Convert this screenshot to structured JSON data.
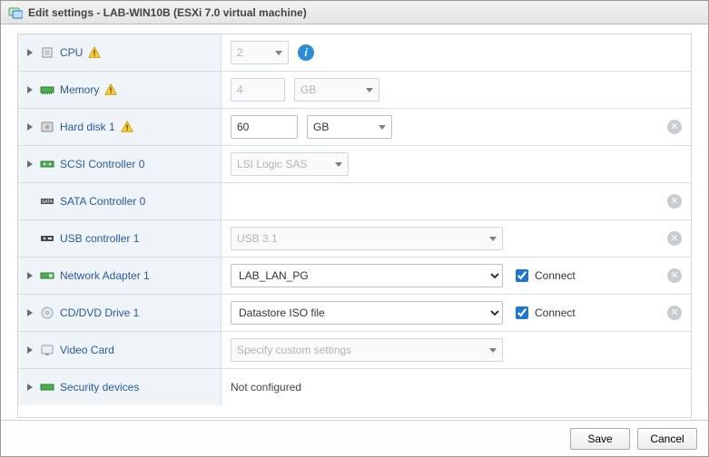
{
  "window": {
    "title": "Edit settings - LAB-WIN10B (ESXi 7.0 virtual machine)"
  },
  "rows": {
    "cpu": {
      "label": "CPU",
      "value": "2",
      "info": true,
      "warn": true,
      "expandable": true
    },
    "memory": {
      "label": "Memory",
      "value": "4",
      "unit": "GB",
      "warn": true,
      "expandable": true
    },
    "harddisk1": {
      "label": "Hard disk 1",
      "value": "60",
      "unit": "GB",
      "warn": true,
      "expandable": true,
      "removable": true
    },
    "scsi0": {
      "label": "SCSI Controller 0",
      "value": "LSI Logic SAS",
      "expandable": true
    },
    "sata0": {
      "label": "SATA Controller 0",
      "removable": true
    },
    "usb1": {
      "label": "USB controller 1",
      "value": "USB 3.1",
      "removable": true
    },
    "net1": {
      "label": "Network Adapter 1",
      "value": "LAB_LAN_PG",
      "connect_label": "Connect",
      "connected": true,
      "expandable": true,
      "removable": true
    },
    "cddvd1": {
      "label": "CD/DVD Drive 1",
      "value": "Datastore ISO file",
      "connect_label": "Connect",
      "connected": true,
      "expandable": true,
      "removable": true
    },
    "video": {
      "label": "Video Card",
      "placeholder": "Specify custom settings",
      "expandable": true
    },
    "security": {
      "label": "Security devices",
      "text": "Not configured",
      "expandable": true
    }
  },
  "footer": {
    "save": "Save",
    "cancel": "Cancel"
  }
}
